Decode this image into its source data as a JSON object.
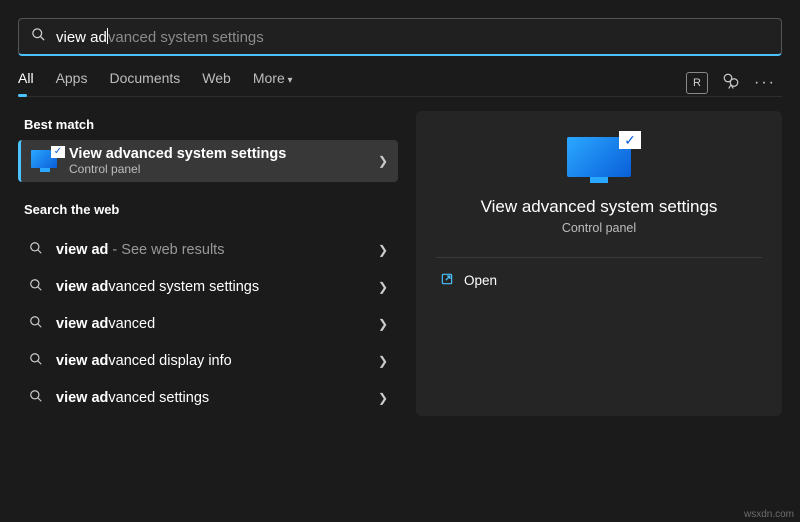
{
  "search": {
    "typed": "view ad",
    "rest": "vanced system settings"
  },
  "tabs": [
    "All",
    "Apps",
    "Documents",
    "Web",
    "More"
  ],
  "header_right": {
    "avatar_letter": "R"
  },
  "left": {
    "best_match_header": "Best match",
    "best_match": {
      "title_bold": "View ad",
      "title_rest": "vanced system settings",
      "subtitle": "Control panel"
    },
    "web_header": "Search the web",
    "web_items": [
      {
        "bold": "view ad",
        "rest": "",
        "suffix": " - See web results"
      },
      {
        "bold": "view ad",
        "rest": "vanced system settings",
        "suffix": ""
      },
      {
        "bold": "view ad",
        "rest": "vanced",
        "suffix": ""
      },
      {
        "bold": "view ad",
        "rest": "vanced display info",
        "suffix": ""
      },
      {
        "bold": "view ad",
        "rest": "vanced settings",
        "suffix": ""
      }
    ]
  },
  "right": {
    "title": "View advanced system settings",
    "subtitle": "Control panel",
    "open": "Open"
  },
  "watermark": "wsxdn.com"
}
